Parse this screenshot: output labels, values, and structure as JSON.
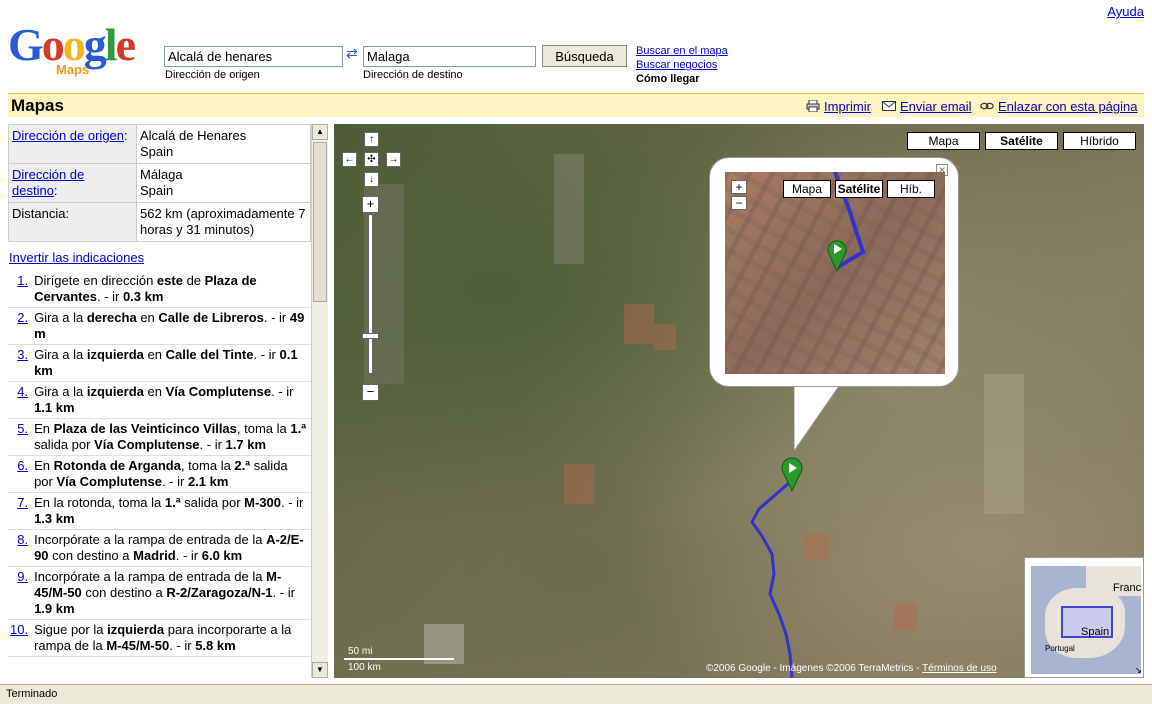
{
  "help_link": "Ayuda",
  "logo": {
    "letters": [
      "G",
      "o",
      "o",
      "g",
      "l",
      "e"
    ],
    "sub": "Maps"
  },
  "search": {
    "origin_value": "Alcalá de henares",
    "origin_label": "Dirección de origen",
    "dest_value": "Malaga",
    "dest_label": "Dirección de destino",
    "button_label": "Búsqueda",
    "swap_icon": "⇄"
  },
  "top_links": {
    "search_map": "Buscar en el mapa",
    "search_business": "Buscar negocios",
    "directions": "Cómo llegar"
  },
  "header": {
    "title": "Mapas",
    "print": "Imprimir",
    "email": "Enviar email",
    "link_page": "Enlazar con esta página"
  },
  "summary": {
    "origin_key": "Dirección de origen",
    "origin_line1": "Alcalá de Henares",
    "origin_line2": "Spain",
    "dest_key": "Dirección de destino",
    "dest_line1": "Málaga",
    "dest_line2": "Spain",
    "distance_key": "Distancia:",
    "distance_value": "562 km (aproximadamente 7 horas y 31 minutos)"
  },
  "invert_link": "Invertir las indicaciones",
  "steps": [
    {
      "num": "1.",
      "html": "Dirígete en dirección <b>este</b> de <b>Plaza de Cervantes</b>. - ir <b>0.3 km</b>"
    },
    {
      "num": "2.",
      "html": "Gira a la <b>derecha</b> en <b>Calle de Libreros</b>. - ir <b>49 m</b>"
    },
    {
      "num": "3.",
      "html": "Gira a la <b>izquierda</b> en <b>Calle del Tinte</b>. - ir <b>0.1 km</b>"
    },
    {
      "num": "4.",
      "html": "Gira a la <b>izquierda</b> en <b>Vía Complutense</b>. - ir <b>1.1 km</b>"
    },
    {
      "num": "5.",
      "html": "En <b>Plaza de las Veinticinco Villas</b>, toma la <b>1.ª</b> salida por <b>Vía Complutense</b>. - ir <b>1.7 km</b>"
    },
    {
      "num": "6.",
      "html": "En <b>Rotonda de Arganda</b>, toma la <b>2.ª</b> salida por <b>Vía Complutense</b>. - ir <b>2.1 km</b>"
    },
    {
      "num": "7.",
      "html": "En la rotonda, toma la <b>1.ª</b> salida por <b>M-300</b>. - ir <b>1.3 km</b>"
    },
    {
      "num": "8.",
      "html": "Incorpórate a la rampa de entrada de la <b>A-2/E-90</b> con destino a <b>Madrid</b>. - ir <b>6.0 km</b>"
    },
    {
      "num": "9.",
      "html": "Incorpórate a la rampa de entrada de la <b>M-45/M-50</b> con destino a <b>R-2/Zaragoza/N-1</b>. - ir <b>1.9 km</b>"
    },
    {
      "num": "10.",
      "html": "Sigue por la <b>izquierda</b> para incorporarte a la rampa de la <b>M-45/M-50</b>. - ir <b>5.8 km</b>"
    }
  ],
  "map": {
    "type_buttons": {
      "map": "Mapa",
      "satellite": "Satélite",
      "hybrid": "Híbrido"
    },
    "scale": {
      "miles": "50 mi",
      "km": "100 km"
    },
    "copyright": "©2006 Google - Imágenes ©2006 TerraMetrics - ",
    "terms": "Términos de uso",
    "overview": {
      "spain": "Spain",
      "france": "France",
      "portugal": "Portugal"
    },
    "bubble": {
      "map": "Mapa",
      "satellite": "Satélite",
      "hybrid": "Híb."
    },
    "route_color": "#3333cc",
    "marker_color": "#2a9a2a"
  },
  "status": "Terminado"
}
